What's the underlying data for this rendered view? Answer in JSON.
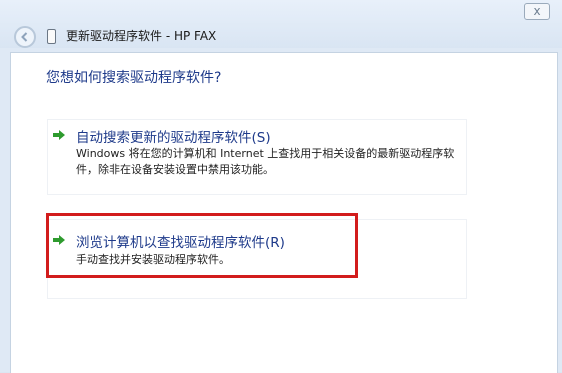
{
  "window": {
    "title": "更新驱动程序软件 - HP FAX",
    "close_label": "x"
  },
  "main": {
    "question": "您想如何搜索驱动程序软件?",
    "options": [
      {
        "title": "自动搜索更新的驱动程序软件(S)",
        "description": "Windows 将在您的计算机和 Internet 上查找用于相关设备的最新驱动程序软件，除非在设备安装设置中禁用该功能。"
      },
      {
        "title": "浏览计算机以查找驱动程序软件(R)",
        "description": "手动查找并安装驱动程序软件。"
      }
    ]
  },
  "icons": {
    "back": "back-arrow-icon",
    "option_arrow": "green-arrow-icon",
    "device": "fax-device-icon"
  },
  "colors": {
    "title_blue": "#1e3a8a",
    "arrow_green": "#2e9b2e",
    "highlight_red": "#d21c1c"
  }
}
